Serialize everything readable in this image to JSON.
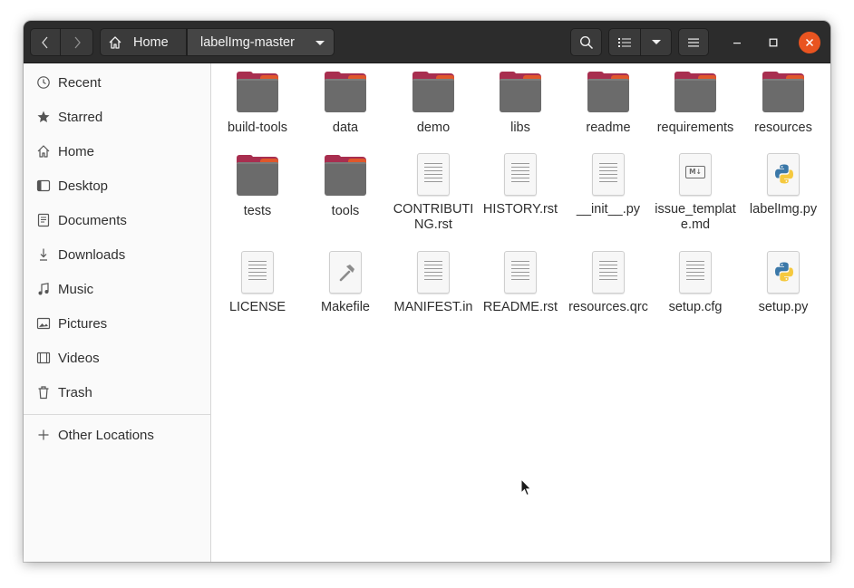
{
  "headerbar": {
    "path_home_label": "Home",
    "path_current_label": "labelImg-master"
  },
  "sidebar": {
    "items": [
      {
        "label": "Recent",
        "icon": "clock-icon"
      },
      {
        "label": "Starred",
        "icon": "star-icon"
      },
      {
        "label": "Home",
        "icon": "home-icon"
      },
      {
        "label": "Desktop",
        "icon": "desktop-icon"
      },
      {
        "label": "Documents",
        "icon": "documents-icon"
      },
      {
        "label": "Downloads",
        "icon": "download-icon"
      },
      {
        "label": "Music",
        "icon": "music-icon"
      },
      {
        "label": "Pictures",
        "icon": "pictures-icon"
      },
      {
        "label": "Videos",
        "icon": "videos-icon"
      },
      {
        "label": "Trash",
        "icon": "trash-icon"
      }
    ],
    "other_locations": {
      "label": "Other Locations",
      "icon": "plus-icon"
    }
  },
  "files": [
    {
      "name": "build-tools",
      "type": "folder"
    },
    {
      "name": "data",
      "type": "folder"
    },
    {
      "name": "demo",
      "type": "folder"
    },
    {
      "name": "libs",
      "type": "folder"
    },
    {
      "name": "readme",
      "type": "folder"
    },
    {
      "name": "requirements",
      "type": "folder"
    },
    {
      "name": "resources",
      "type": "folder"
    },
    {
      "name": "tests",
      "type": "folder"
    },
    {
      "name": "tools",
      "type": "folder"
    },
    {
      "name": "CONTRIBUTING.rst",
      "type": "text"
    },
    {
      "name": "HISTORY.rst",
      "type": "text"
    },
    {
      "name": "__init__.py",
      "type": "text"
    },
    {
      "name": "issue_template.md",
      "type": "markdown"
    },
    {
      "name": "labelImg.py",
      "type": "python"
    },
    {
      "name": "LICENSE",
      "type": "text"
    },
    {
      "name": "Makefile",
      "type": "makefile"
    },
    {
      "name": "MANIFEST.in",
      "type": "text"
    },
    {
      "name": "README.rst",
      "type": "text"
    },
    {
      "name": "resources.qrc",
      "type": "text"
    },
    {
      "name": "setup.cfg",
      "type": "text"
    },
    {
      "name": "setup.py",
      "type": "python"
    }
  ],
  "colors": {
    "headerbar": "#2c2c2c",
    "folder_accent": "#a82e4f",
    "folder_tab_orange": "#e0572b",
    "close_button": "#e95420"
  }
}
